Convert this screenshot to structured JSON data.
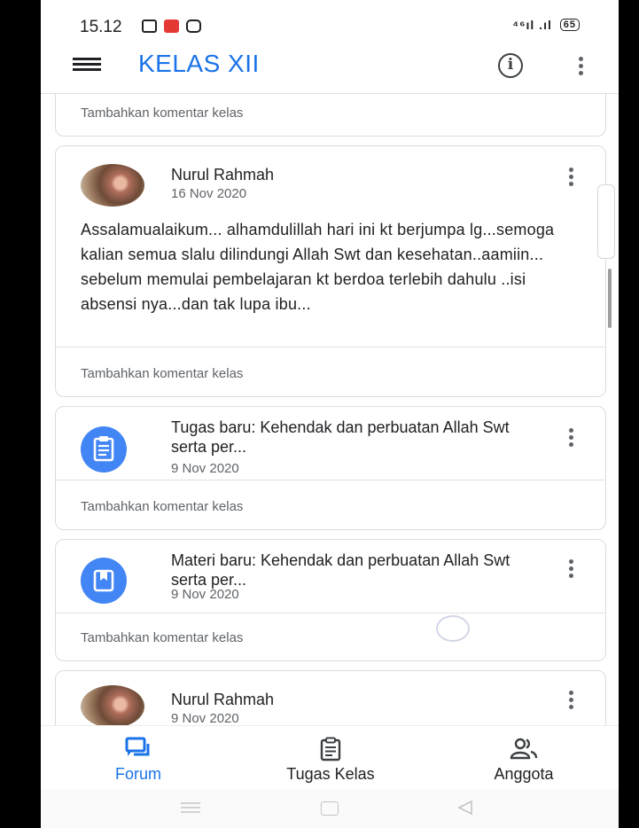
{
  "status_bar": {
    "time": "15.12",
    "signal": "⁴⁶ıl .ıl",
    "battery": "65"
  },
  "app_bar": {
    "title": "KELAS XII"
  },
  "feed": {
    "comment_placeholder": "Tambahkan komentar kelas",
    "posts": [
      {
        "author": "Nurul Rahmah",
        "date": "16 Nov 2020",
        "body": "Assalamualaikum... alhamdulillah hari ini kt berjumpa lg...semoga kalian semua slalu dilindungi Allah Swt dan kesehatan..aamiin... sebelum memulai pembelajaran kt berdoa terlebih dahulu ..isi absensi nya...dan tak lupa ibu..."
      },
      {
        "title": "Tugas baru: Kehendak dan perbuatan Allah Swt serta per...",
        "date": "9 Nov 2020",
        "icon": "assignment-icon"
      },
      {
        "title": "Materi baru: Kehendak dan perbuatan Allah Swt serta per...",
        "date": "9 Nov 2020",
        "icon": "material-icon"
      },
      {
        "author": "Nurul Rahmah",
        "date": "9 Nov 2020"
      }
    ]
  },
  "bottom_nav": {
    "items": [
      {
        "label": "Forum",
        "icon": "forum-icon",
        "active": true
      },
      {
        "label": "Tugas Kelas",
        "icon": "classwork-icon",
        "active": false
      },
      {
        "label": "Anggota",
        "icon": "people-icon",
        "active": false
      }
    ]
  },
  "colors": {
    "accent": "#1a73e8",
    "icon_circle": "#4285f4",
    "text": "#202124",
    "secondary_text": "#5f6368"
  }
}
